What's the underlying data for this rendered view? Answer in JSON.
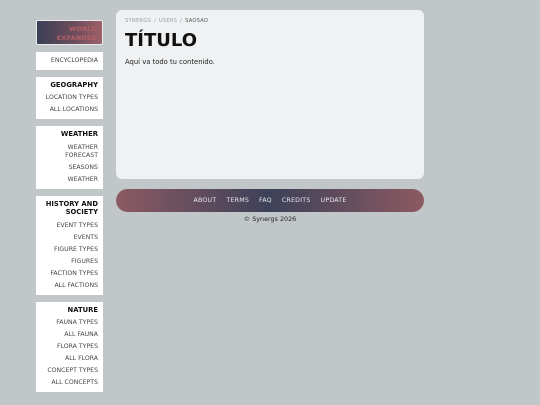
{
  "sidebar": {
    "brand_line1": "WORLD",
    "brand_line2": "EXPANDED",
    "encyclopedia": "ENCYCLOPEDIA",
    "geography": {
      "title": "GEOGRAPHY",
      "items": [
        "LOCATION TYPES",
        "ALL LOCATIONS"
      ]
    },
    "weather": {
      "title": "WEATHER",
      "items": [
        "WEATHER FORECAST",
        "SEASONS",
        "WEATHER"
      ]
    },
    "history": {
      "title": "HISTORY AND SOCIETY",
      "items": [
        "EVENT TYPES",
        "EVENTS",
        "FIGURE TYPES",
        "FIGURES",
        "FACTION TYPES",
        "ALL FACTIONS"
      ]
    },
    "nature": {
      "title": "NATURE",
      "items": [
        "FAUNA TYPES",
        "ALL FAUNA",
        "FLORA TYPES",
        "ALL FLORA",
        "CONCEPT TYPES",
        "ALL CONCEPTS"
      ]
    }
  },
  "breadcrumb": [
    "SYNERGS",
    "USERS",
    "SAOSAO"
  ],
  "main": {
    "title": "TÍTULO",
    "content": "Aquí va todo tu contenido."
  },
  "footer": {
    "links": [
      "ABOUT",
      "TERMS",
      "FAQ",
      "CREDITS",
      "UPDATE"
    ],
    "copyright": "© Synergs 2026"
  }
}
